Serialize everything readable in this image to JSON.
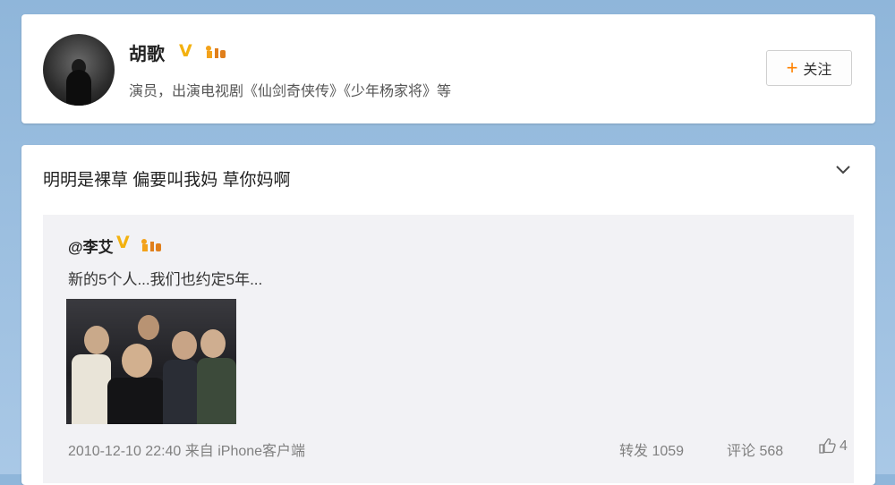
{
  "profile": {
    "name": "胡歌",
    "verified_badge": "V",
    "club_badge": "club",
    "description": "演员，出演电视剧《仙剑奇侠传》《少年杨家将》等",
    "follow_label": "关注",
    "follow_icon": "plus-icon"
  },
  "post": {
    "text": "明明是裸草 偏要叫我妈 草你妈啊",
    "repost": {
      "author": "@李艾",
      "verified_badge": "V",
      "club_badge": "club",
      "text": "新的5个人...我们也约定5年...",
      "meta": "2010-12-10 22:40 来自 iPhone客户端",
      "repost_label": "转发 1059",
      "comment_label": "评论 568",
      "like_count": "4"
    }
  },
  "colors": {
    "accent": "#ff8200",
    "verified": "#f3b10f",
    "background": "#a9c8e6"
  }
}
